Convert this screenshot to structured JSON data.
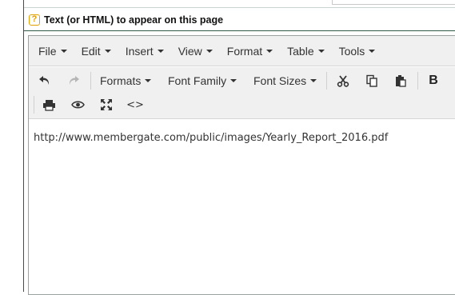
{
  "section": {
    "help_glyph": "?",
    "title": "Text (or HTML) to appear on this page"
  },
  "menubar": {
    "items": [
      {
        "label": "File"
      },
      {
        "label": "Edit"
      },
      {
        "label": "Insert"
      },
      {
        "label": "View"
      },
      {
        "label": "Format"
      },
      {
        "label": "Table"
      },
      {
        "label": "Tools"
      }
    ]
  },
  "toolbar": {
    "formats_label": "Formats",
    "font_family_label": "Font Family",
    "font_sizes_label": "Font Sizes",
    "bold_label": "B",
    "code_label": "<>",
    "icons": [
      "undo-icon",
      "redo-icon",
      "cut-icon",
      "copy-icon",
      "paste-icon",
      "bold-icon",
      "print-icon",
      "preview-icon",
      "fullscreen-icon",
      "code-icon"
    ]
  },
  "editor": {
    "content": "http://www.membergate.com/public/images/Yearly_Report_2016.pdf"
  },
  "colors": {
    "rail": "#2f5a46",
    "help_icon": "#e0a000",
    "toolbar_bg": "#f0f0f0"
  }
}
